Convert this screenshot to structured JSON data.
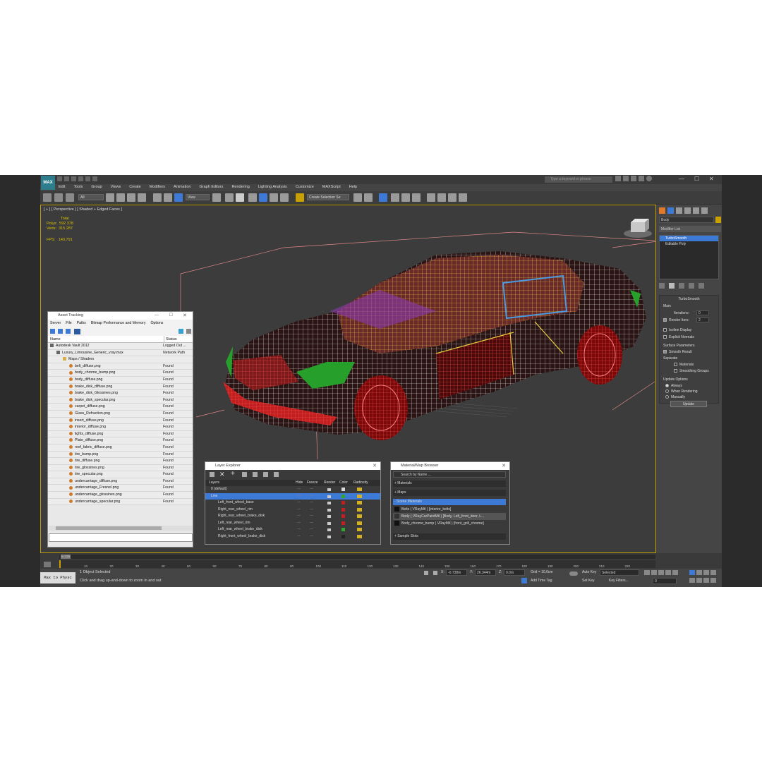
{
  "app": {
    "logo_label": "MAX",
    "search_placeholder": "Type a keyword or phrase"
  },
  "menu": [
    "Edit",
    "Tools",
    "Group",
    "Views",
    "Create",
    "Modifiers",
    "Animation",
    "Graph Editors",
    "Rendering",
    "Lighting Analysis",
    "Customize",
    "MAXScript",
    "Help"
  ],
  "toolbar": {
    "filter": "All",
    "ref_coord": "View",
    "selection_set": "Create Selection Se"
  },
  "viewport": {
    "label": "[ + ] [ Perspective ] [ Shaded + Edged Faces ]",
    "stats_total": "Total",
    "polys_label": "Polys:",
    "polys_value": "592 378",
    "verts_label": "Verts:",
    "verts_value": "315 287",
    "fps_label": "FPS:",
    "fps_value": "143.791"
  },
  "cmdpanel": {
    "object_name": "Body",
    "modifier_list": "Modifier List",
    "stack": [
      "TurboSmooth",
      "Editable Poly"
    ],
    "rollout_title": "TurboSmooth",
    "main_label": "Main",
    "iterations_label": "Iterations:",
    "iterations_value": "0",
    "render_iters_label": "Render Iters:",
    "render_iters_value": "2",
    "isoline": "Isoline Display",
    "explicit": "Explicit Normals",
    "surface_label": "Surface Parameters",
    "smooth_result": "Smooth Result",
    "separate_label": "Separate",
    "materials": "Materials",
    "smoothing_groups": "Smoothing Groups",
    "update_label": "Update Options",
    "always": "Always",
    "when_rendering": "When Rendering",
    "manually": "Manually",
    "update_btn": "Update"
  },
  "asset_tracking": {
    "title": "Asset Tracking",
    "menu": [
      "Server",
      "File",
      "Paths",
      "Bitmap Performance and Memory",
      "Options"
    ],
    "col_name": "Name",
    "col_status": "Status",
    "rows": [
      {
        "name": "Autodesk Vault 2012",
        "status": "Logged Out ...",
        "indent": 0,
        "kind": "db"
      },
      {
        "name": "Luxury_Limousine_Generic_vray.max",
        "status": "Network Path",
        "indent": 1,
        "kind": "file"
      },
      {
        "name": "Maps / Shaders",
        "status": "",
        "indent": 2,
        "kind": "fold"
      },
      {
        "name": "belt_diffuse.png",
        "status": "Found",
        "indent": 3,
        "kind": "img"
      },
      {
        "name": "body_chrome_bump.png",
        "status": "Found",
        "indent": 3,
        "kind": "img"
      },
      {
        "name": "body_diffuse.png",
        "status": "Found",
        "indent": 3,
        "kind": "img"
      },
      {
        "name": "brake_disk_diffuse.png",
        "status": "Found",
        "indent": 3,
        "kind": "img"
      },
      {
        "name": "brake_disk_Glossines.png",
        "status": "Found",
        "indent": 3,
        "kind": "img"
      },
      {
        "name": "brake_disk_specular.png",
        "status": "Found",
        "indent": 3,
        "kind": "img"
      },
      {
        "name": "carpet_diffuse.png",
        "status": "Found",
        "indent": 3,
        "kind": "img"
      },
      {
        "name": "Glass_Refraction.png",
        "status": "Found",
        "indent": 3,
        "kind": "img"
      },
      {
        "name": "insert_diffuse.png",
        "status": "Found",
        "indent": 3,
        "kind": "img"
      },
      {
        "name": "interior_diffuse.png",
        "status": "Found",
        "indent": 3,
        "kind": "img"
      },
      {
        "name": "lights_diffuse.png",
        "status": "Found",
        "indent": 3,
        "kind": "img"
      },
      {
        "name": "Plate_diffuse.png",
        "status": "Found",
        "indent": 3,
        "kind": "img"
      },
      {
        "name": "roof_fabric_diffuse.png",
        "status": "Found",
        "indent": 3,
        "kind": "img"
      },
      {
        "name": "tire_bump.png",
        "status": "Found",
        "indent": 3,
        "kind": "img"
      },
      {
        "name": "tire_diffuse.png",
        "status": "Found",
        "indent": 3,
        "kind": "img"
      },
      {
        "name": "tire_glossines.png",
        "status": "Found",
        "indent": 3,
        "kind": "img"
      },
      {
        "name": "tire_specular.png",
        "status": "Found",
        "indent": 3,
        "kind": "img"
      },
      {
        "name": "undercarriage_diffuse.png",
        "status": "Found",
        "indent": 3,
        "kind": "img"
      },
      {
        "name": "undercarriage_Fresnel.png",
        "status": "Found",
        "indent": 3,
        "kind": "img"
      },
      {
        "name": "undercarriage_glossines.png",
        "status": "Found",
        "indent": 3,
        "kind": "img"
      },
      {
        "name": "undercarriage_specular.png",
        "status": "Found",
        "indent": 3,
        "kind": "img"
      }
    ]
  },
  "layer_explorer": {
    "title": "Layer Explorer",
    "cols": [
      "Layers",
      "Hide",
      "Freeze",
      "Render",
      "Color",
      "Radiosity"
    ],
    "rows": [
      {
        "name": "0 (default)",
        "color": "#d8d8d8",
        "sel": false,
        "indent": 0
      },
      {
        "name": "Line",
        "color": "#2fa82f",
        "sel": true,
        "indent": 0
      },
      {
        "name": "Left_front_wheel_base",
        "color": "#c02020",
        "sel": false,
        "indent": 1
      },
      {
        "name": "Right_rear_wheel_rim",
        "color": "#c02020",
        "sel": false,
        "indent": 1
      },
      {
        "name": "Right_rear_wheel_brake_disk",
        "color": "#c02020",
        "sel": false,
        "indent": 1
      },
      {
        "name": "Left_rear_wheel_rim",
        "color": "#c02020",
        "sel": false,
        "indent": 1
      },
      {
        "name": "Left_rear_wheel_brake_disk",
        "color": "#2fa82f",
        "sel": false,
        "indent": 1
      },
      {
        "name": "Right_front_wheel_brake_disk",
        "color": "#222222",
        "sel": false,
        "indent": 1
      }
    ]
  },
  "material_browser": {
    "title": "Material/Map Browser",
    "search": "Search by Name ...",
    "sections": [
      "+ Materials",
      "+ Maps",
      "- Scene Materials"
    ],
    "materials": [
      "Belts ( VRayMtl ) [interior_belts]",
      "Body ( VRayCarPaintMtl ) [Body, Left_front_door, L...",
      "Body_chrome_bump ( VRayMtl ) [front_grill_chrome]"
    ],
    "sample": "+ Sample Slots"
  },
  "timeline": {
    "frame": "0 / 225",
    "ticks": [
      "10",
      "20",
      "30",
      "40",
      "50",
      "60",
      "70",
      "80",
      "90",
      "100",
      "110",
      "120",
      "130",
      "140",
      "150",
      "160",
      "170",
      "180",
      "190",
      "200",
      "210",
      "220"
    ]
  },
  "statusbar": {
    "script_btn": "Max to Physc",
    "selected": "1 Object Selected",
    "prompt": "Click and drag up-and-down to zoom in and out",
    "x_label": "X:",
    "x_value": "-0.738m",
    "y_label": "Y:",
    "y_value": "26.344m",
    "z_label": "Z:",
    "z_value": "0.0m",
    "grid": "Grid = 10,0cm",
    "add_time_tag": "Add Time Tag",
    "auto_key": "Auto Key",
    "selected_dd": "Selected",
    "set_key": "Set Key",
    "key_filters": "Key Filters...",
    "frame_value": "0"
  }
}
